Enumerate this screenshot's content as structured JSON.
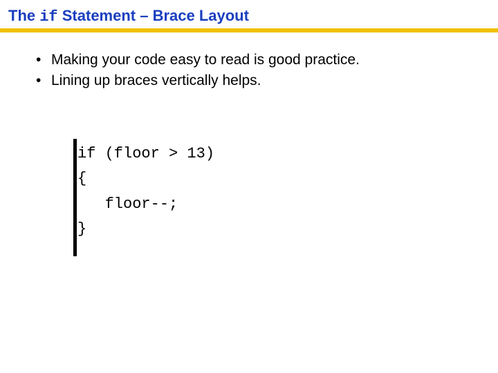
{
  "title": {
    "prefix": "The ",
    "keyword": "if",
    "suffix": " Statement – Brace Layout"
  },
  "bullets": [
    "Making your code easy to read is good practice.",
    "Lining up braces vertically helps."
  ],
  "code": {
    "line1": "if (floor > 13)",
    "line2": "{",
    "line3": "   floor--;",
    "line4": "}"
  }
}
